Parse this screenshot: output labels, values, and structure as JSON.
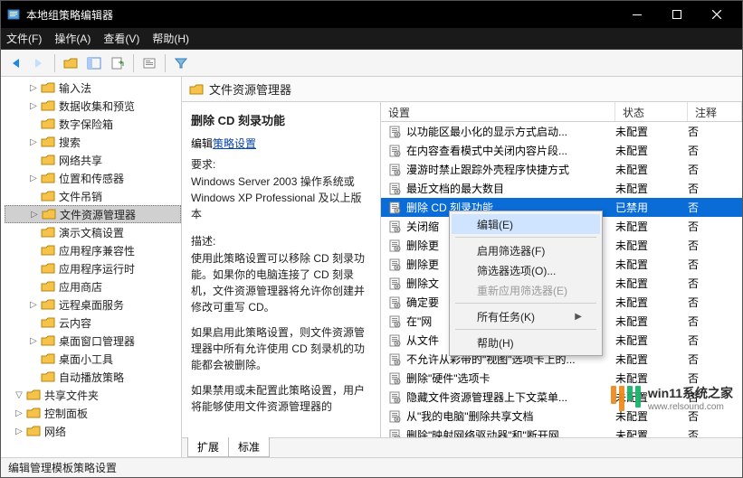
{
  "window": {
    "title": "本地组策略编辑器"
  },
  "menubar": {
    "file": "文件(F)",
    "action": "操作(A)",
    "view": "查看(V)",
    "help": "帮助(H)"
  },
  "tree": {
    "items": [
      {
        "label": "输入法",
        "exp": "closed"
      },
      {
        "label": "数据收集和预览",
        "exp": "closed"
      },
      {
        "label": "数字保险箱",
        "exp": "none"
      },
      {
        "label": "搜索",
        "exp": "closed"
      },
      {
        "label": "网络共享",
        "exp": "none"
      },
      {
        "label": "位置和传感器",
        "exp": "closed"
      },
      {
        "label": "文件吊销",
        "exp": "none"
      },
      {
        "label": "文件资源管理器",
        "exp": "closed",
        "selected": true
      },
      {
        "label": "演示文稿设置",
        "exp": "none"
      },
      {
        "label": "应用程序兼容性",
        "exp": "none"
      },
      {
        "label": "应用程序运行时",
        "exp": "none"
      },
      {
        "label": "应用商店",
        "exp": "none"
      },
      {
        "label": "远程桌面服务",
        "exp": "closed"
      },
      {
        "label": "云内容",
        "exp": "none"
      },
      {
        "label": "桌面窗口管理器",
        "exp": "closed"
      },
      {
        "label": "桌面小工具",
        "exp": "none"
      },
      {
        "label": "自动播放策略",
        "exp": "none"
      }
    ],
    "after": [
      {
        "label": "共享文件夹",
        "exp": "open"
      },
      {
        "label": "控制面板",
        "exp": "closed"
      },
      {
        "label": "网络",
        "exp": "closed"
      }
    ]
  },
  "breadcrumb": {
    "text": "文件资源管理器"
  },
  "detail": {
    "title": "删除 CD 刻录功能",
    "edit_label": "编辑",
    "edit_link": "策略设置",
    "req_head": "要求:",
    "req_body": "Windows Server 2003 操作系统或 Windows XP Professional 及以上版本",
    "desc_head": "描述:",
    "desc_p1": "使用此策略设置可以移除 CD 刻录功能。如果你的电脑连接了 CD 刻录机，文件资源管理器将允许你创建并修改可重写 CD。",
    "desc_p2": "如果启用此策略设置，则文件资源管理器中所有允许使用 CD 刻录机的功能都会被删除。",
    "desc_p3": "如果禁用或未配置此策略设置，用户将能够使用文件资源管理器的"
  },
  "columns": {
    "setting": "设置",
    "state": "状态",
    "comment": "注释"
  },
  "rows": [
    {
      "setting": "以功能区最小化的显示方式启动...",
      "state": "未配置",
      "comment": "否"
    },
    {
      "setting": "在内容查看模式中关闭内容片段...",
      "state": "未配置",
      "comment": "否"
    },
    {
      "setting": "漫游时禁止跟踪外壳程序快捷方式",
      "state": "未配置",
      "comment": "否"
    },
    {
      "setting": "最近文档的最大数目",
      "state": "未配置",
      "comment": "否"
    },
    {
      "setting": "删除 CD 刻录功能",
      "state": "已禁用",
      "comment": "否",
      "selected": true
    },
    {
      "setting": "关闭缩",
      "state": "未配置",
      "comment": "否"
    },
    {
      "setting": "删除更",
      "state": "未配置",
      "comment": "否"
    },
    {
      "setting": "删除更",
      "state": "未配置",
      "comment": "否"
    },
    {
      "setting": "删除文",
      "state": "未配置",
      "comment": "否"
    },
    {
      "setting": "确定要",
      "state": "未配置",
      "comment": "否"
    },
    {
      "setting": "在\"网",
      "state": "未配置",
      "comment": "否"
    },
    {
      "setting": "从文件",
      "state": "未配置",
      "comment": "否"
    },
    {
      "setting": "不允许从彩带的\"视图\"选项卡上的...",
      "state": "未配置",
      "comment": "否"
    },
    {
      "setting": "删除\"硬件\"选项卡",
      "state": "未配置",
      "comment": "否"
    },
    {
      "setting": "隐藏文件资源管理器上下文菜单...",
      "state": "未配置",
      "comment": "否"
    },
    {
      "setting": "从\"我的电脑\"删除共享文档",
      "state": "未配置",
      "comment": "否"
    },
    {
      "setting": "删除\"映射网络驱动器\"和\"断开网...",
      "state": "未配置",
      "comment": "否"
    }
  ],
  "context_menu": {
    "edit": "编辑(E)",
    "filter_on": "启用筛选器(F)",
    "filter_opts": "筛选器选项(O)...",
    "reapply": "重新应用筛选器(E)",
    "all_tasks": "所有任务(K)",
    "help": "帮助(H)"
  },
  "tabs": {
    "ext": "扩展",
    "std": "标准"
  },
  "statusbar": {
    "text": "编辑管理模板策略设置"
  },
  "watermark": {
    "site": "win11系统之家",
    "url": "www.relsound.com"
  }
}
